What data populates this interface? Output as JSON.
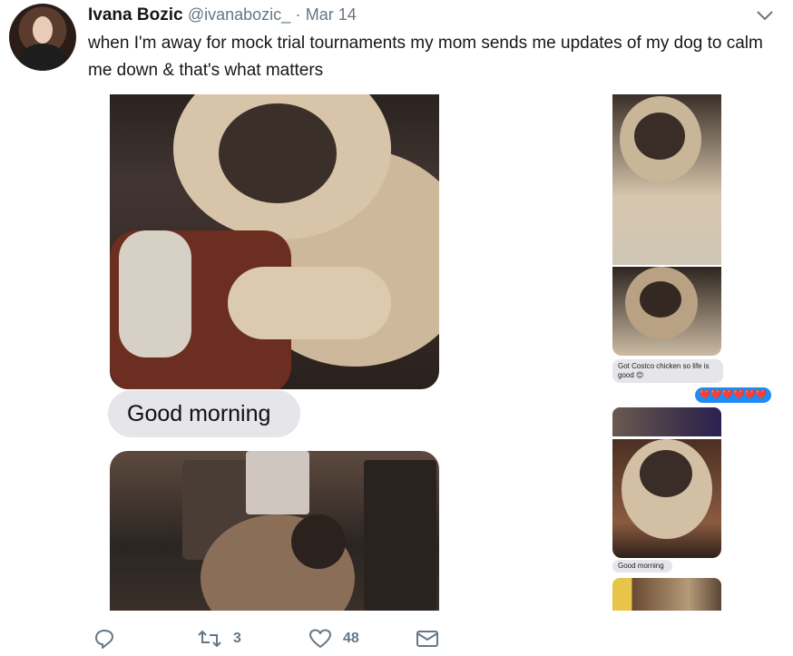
{
  "tweet": {
    "name": "Ivana Bozic",
    "handle": "@ivanabozic_",
    "separator": "·",
    "date": "Mar 14",
    "text": "when I'm away for mock trial tournaments my mom sends me updates of my dog to calm me down & that's what matters"
  },
  "messages": {
    "left_bubble": "Good morning",
    "right_bubble_1": "Got Costco chicken so life is good 😊",
    "right_bubble_blue": "❤️❤️❤️❤️❤️❤️",
    "right_bubble_2": "Good morning"
  },
  "actions": {
    "reply_count": "",
    "retweet_count": "3",
    "like_count": "48"
  },
  "icons": [
    "reply-icon",
    "retweet-icon",
    "heart-icon",
    "message-icon",
    "chevron-down-icon"
  ],
  "colors": {
    "text": "#14171a",
    "muted": "#657786",
    "imessage_gray": "#e5e5ea",
    "imessage_blue": "#1d8cf8"
  }
}
